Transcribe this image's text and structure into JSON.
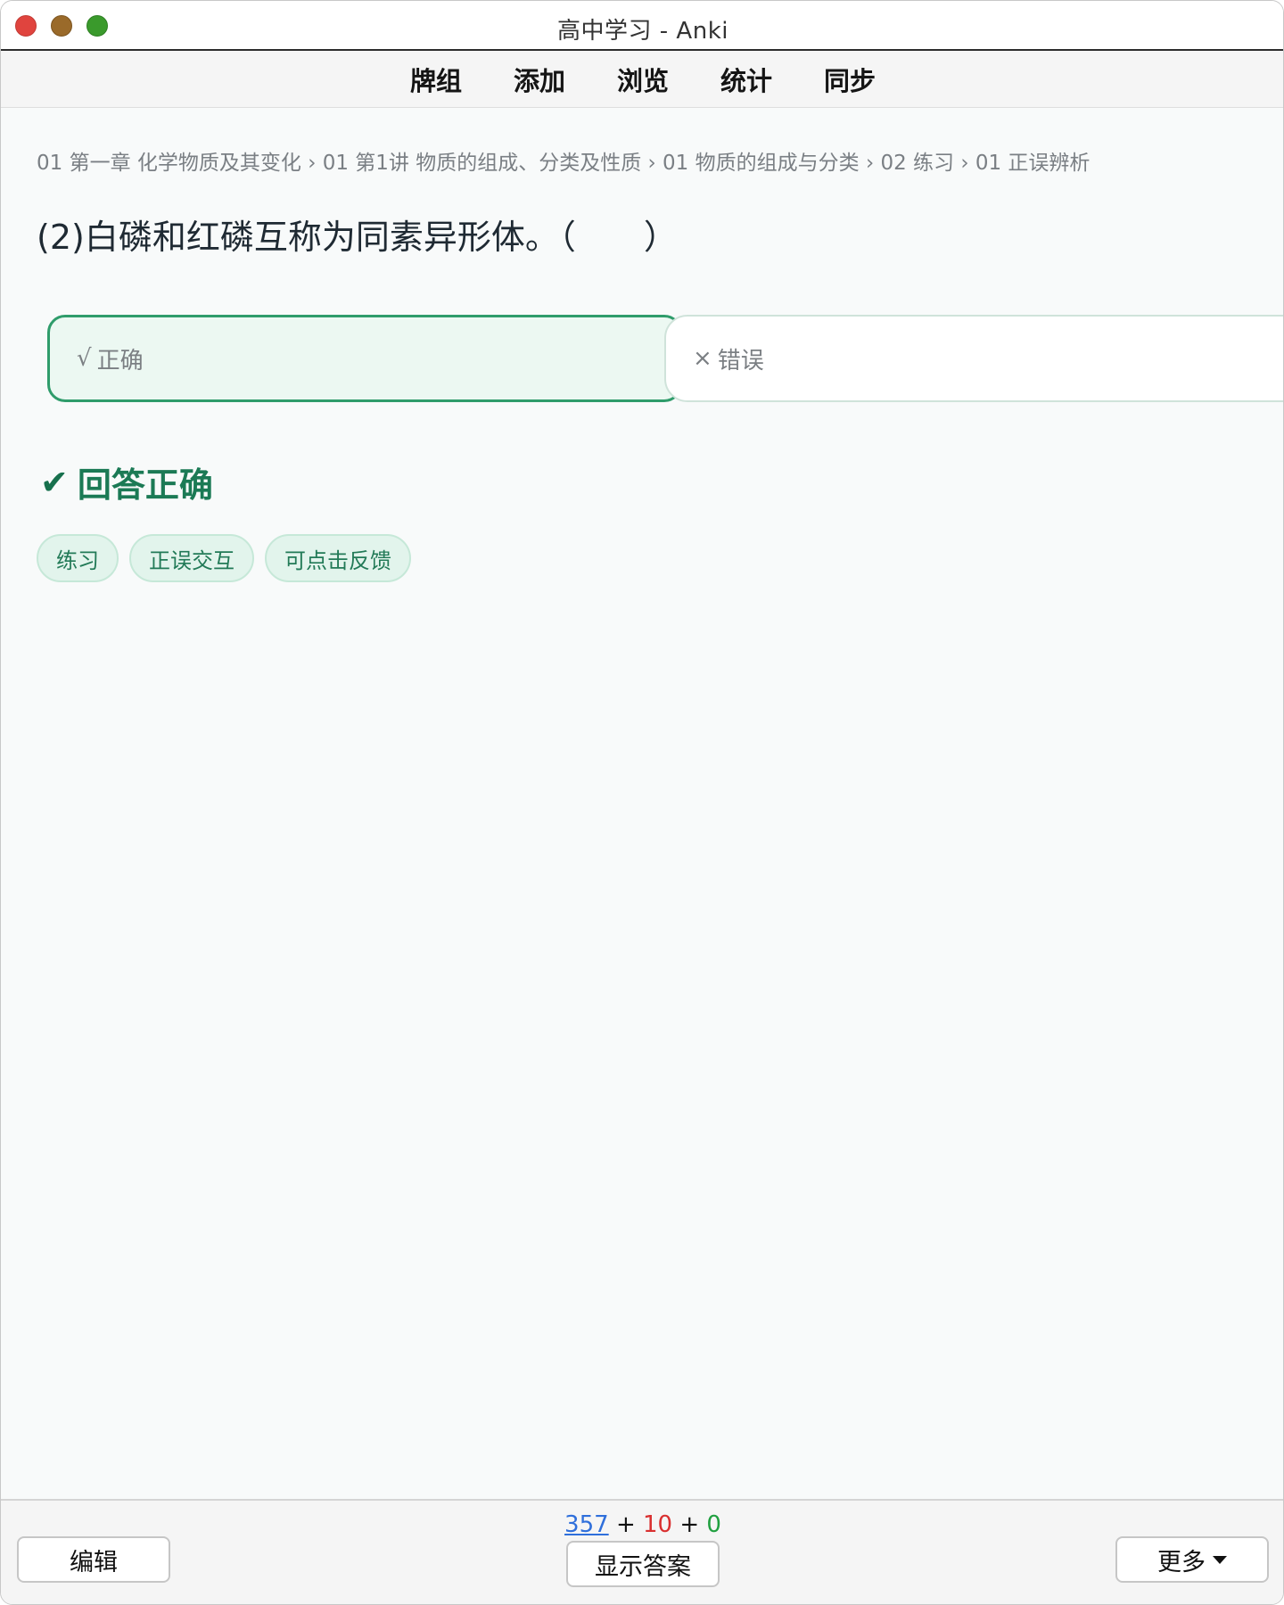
{
  "window": {
    "title": "高中学习 - Anki"
  },
  "toolbar": {
    "items": [
      "牌组",
      "添加",
      "浏览",
      "统计",
      "同步"
    ]
  },
  "card": {
    "breadcrumb": "01 第一章 化学物质及其变化 › 01 第1讲 物质的组成、分类及性质 › 01 物质的组成与分类 › 02 练习 › 01 正误辨析",
    "question": "(2)白磷和红磷互称为同素异形体。（　　）",
    "options": {
      "correct": {
        "mark": "√",
        "label": "正确"
      },
      "wrong": {
        "mark": "×",
        "label": "错误"
      }
    },
    "result": {
      "icon": "check-icon",
      "mark": "✔",
      "text": "回答正确"
    },
    "tags": [
      "练习",
      "正误交互",
      "可点击反馈"
    ]
  },
  "bottom": {
    "counts": {
      "new": "357",
      "learn": "10",
      "review": "0",
      "plus": "+"
    },
    "edit_label": "编辑",
    "show_answer_label": "显示答案",
    "more_label": "更多"
  },
  "colors": {
    "accent_green": "#2f9c6b",
    "new_count": "#2f6fdb",
    "learn_count": "#d93030",
    "review_count": "#20a040"
  }
}
